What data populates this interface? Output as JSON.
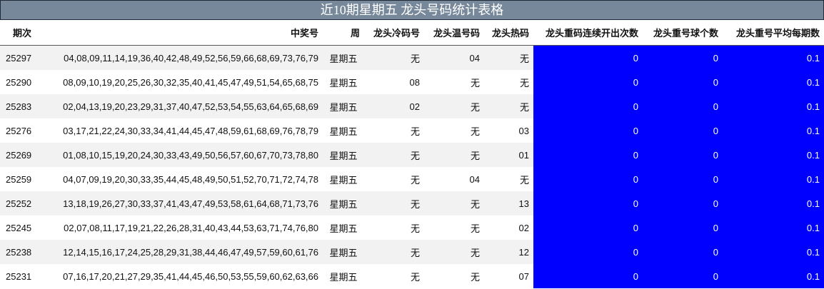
{
  "title": "近10期星期五 龙头号码统计表格",
  "headers": {
    "period": "期次",
    "numbers": "中奖号",
    "week": "周",
    "cold": "龙头冷码号",
    "warm": "龙头温号码",
    "hot": "龙头热码",
    "repeat_count": "龙头重码连续开出次数",
    "repeat_balls": "龙头重号球个数",
    "repeat_avg": "龙头重号平均每期数"
  },
  "rows": [
    {
      "period": "25297",
      "numbers": "04,08,09,11,14,19,36,40,42,48,49,52,56,59,66,68,69,73,76,79",
      "week": "星期五",
      "cold": "无",
      "warm": "04",
      "hot": "无",
      "repeat_count": "0",
      "repeat_balls": "0",
      "repeat_avg": "0.1"
    },
    {
      "period": "25290",
      "numbers": "08,09,10,19,20,25,26,30,32,35,40,41,45,47,49,51,54,65,68,75",
      "week": "星期五",
      "cold": "08",
      "warm": "无",
      "hot": "无",
      "repeat_count": "0",
      "repeat_balls": "0",
      "repeat_avg": "0.1"
    },
    {
      "period": "25283",
      "numbers": "02,04,13,19,20,23,29,31,37,40,47,52,53,54,55,63,64,65,68,69",
      "week": "星期五",
      "cold": "02",
      "warm": "无",
      "hot": "无",
      "repeat_count": "0",
      "repeat_balls": "0",
      "repeat_avg": "0.1"
    },
    {
      "period": "25276",
      "numbers": "03,17,21,22,24,30,33,34,41,44,45,47,48,59,61,68,69,76,78,79",
      "week": "星期五",
      "cold": "无",
      "warm": "无",
      "hot": "03",
      "repeat_count": "0",
      "repeat_balls": "0",
      "repeat_avg": "0.1"
    },
    {
      "period": "25269",
      "numbers": "01,08,10,15,19,20,24,30,33,43,49,50,56,57,60,67,70,73,78,80",
      "week": "星期五",
      "cold": "无",
      "warm": "无",
      "hot": "01",
      "repeat_count": "0",
      "repeat_balls": "0",
      "repeat_avg": "0.1"
    },
    {
      "period": "25259",
      "numbers": "04,07,09,19,20,30,33,35,44,45,48,49,50,51,52,70,71,72,74,78",
      "week": "星期五",
      "cold": "无",
      "warm": "04",
      "hot": "无",
      "repeat_count": "0",
      "repeat_balls": "0",
      "repeat_avg": "0.1"
    },
    {
      "period": "25252",
      "numbers": "13,18,19,26,27,30,33,37,41,43,47,49,53,58,61,64,68,71,73,76",
      "week": "星期五",
      "cold": "无",
      "warm": "无",
      "hot": "13",
      "repeat_count": "0",
      "repeat_balls": "0",
      "repeat_avg": "0.1"
    },
    {
      "period": "25245",
      "numbers": "02,07,08,11,17,19,21,22,26,28,31,40,43,44,53,63,71,74,76,80",
      "week": "星期五",
      "cold": "无",
      "warm": "无",
      "hot": "02",
      "repeat_count": "0",
      "repeat_balls": "0",
      "repeat_avg": "0.1"
    },
    {
      "period": "25238",
      "numbers": "12,14,15,16,17,24,25,28,29,31,38,44,46,47,49,57,59,60,61,76",
      "week": "星期五",
      "cold": "无",
      "warm": "无",
      "hot": "12",
      "repeat_count": "0",
      "repeat_balls": "0",
      "repeat_avg": "0.1"
    },
    {
      "period": "25231",
      "numbers": "07,16,17,20,21,27,29,35,41,44,45,46,50,53,55,59,60,62,63,66",
      "week": "星期五",
      "cold": "无",
      "warm": "无",
      "hot": "07",
      "repeat_count": "0",
      "repeat_balls": "0",
      "repeat_avg": "0.1"
    }
  ],
  "colors": {
    "title_bg": "#77889b",
    "stat_bg": "#0000ff",
    "stat_text": "#ffffff",
    "stripe": "#f2f2f2"
  }
}
